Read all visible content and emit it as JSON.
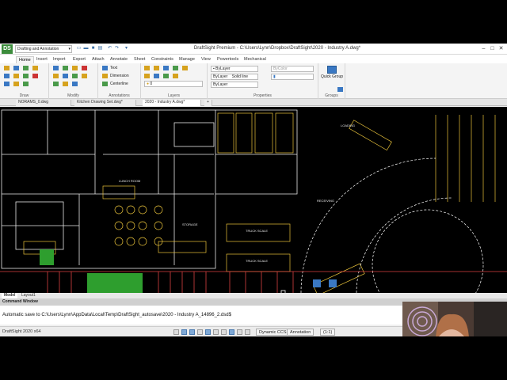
{
  "window": {
    "title": "DraftSight Premium - C:\\Users\\Lynn\\Dropbox\\DraftSight\\2020 - Industry A.dwg*",
    "app_logo": "DS",
    "workspace": "Drafting and Annotation"
  },
  "ribbon_tabs": [
    "Home",
    "Insert",
    "Import",
    "Export",
    "Attach",
    "Annotate",
    "Sheet",
    "Constraints",
    "Manage",
    "View",
    "Powertools",
    "Mechanical"
  ],
  "ribbon": {
    "panels": [
      "Draw",
      "Modify",
      "Annotations",
      "Layers",
      "Properties",
      "Groups"
    ],
    "annotations": {
      "text": "Text",
      "dimension": "Dimension",
      "centerline": "Centerline"
    },
    "layers": {
      "current_layer": "0"
    },
    "properties": {
      "color": "ByLayer",
      "linestyle": "ByLayer",
      "linestyle_name": "Solid line",
      "lineweight": "ByLayer",
      "plotstyle": "ByColor"
    },
    "groups": {
      "quick_group": "Quick Group"
    }
  },
  "doc_tabs": [
    "NORAMS_0.dwg",
    "Kitchen Drawing Set.dwg*",
    "2020 - Industry A.dwg*"
  ],
  "doc_tabs_add": "+",
  "layout_tabs": [
    "Model",
    "Layout1"
  ],
  "command_window": {
    "title": "Command Window",
    "text": "Automatic save to C:\\Users\\Lynn\\AppData\\Local\\Temp\\DraftSight_autosave\\2020 - Industry A_14896_2.dsd$"
  },
  "status": {
    "version": "DraftSight 2020 x64",
    "dynamic_ccs": "Dynamic CCS",
    "annotation": "Annotation",
    "scale": "(1:1)"
  },
  "canvas_labels": {
    "lunch_room": "LUNCH ROOM",
    "truck_scale_1": "TRUCK SCALE",
    "truck_scale_2": "TRUCK SCALE",
    "loading": "LOADING",
    "receiving": "RECEIVING",
    "storage": "STORAGE"
  },
  "colors": {
    "accent": "#3a78c3",
    "drawing_bg": "#000000",
    "cad_yellow": "#e8c23a",
    "cad_white": "#e8e8e8",
    "cad_green": "#3fbf3f",
    "cad_red": "#d94040"
  }
}
